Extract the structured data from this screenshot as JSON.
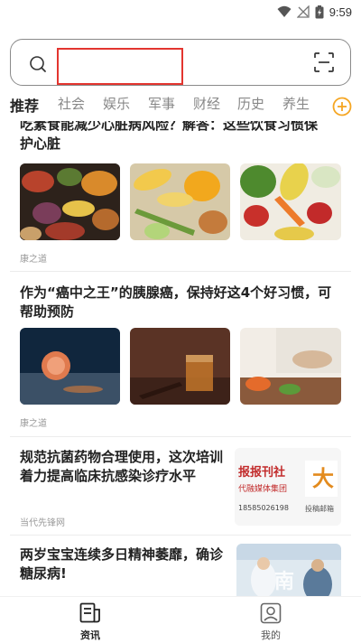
{
  "status": {
    "time": "9:59"
  },
  "search": {
    "placeholder": ""
  },
  "tabs": [
    "推荐",
    "社会",
    "娱乐",
    "军事",
    "财经",
    "历史",
    "养生"
  ],
  "articles": [
    {
      "title_line1": "吃素食能减少心脏病风险？解答：这些饮食习惯保",
      "title_line2": "护心脏",
      "source": "康之道"
    },
    {
      "title_line1": "作为“癌中之王”的胰腺癌，保持好这4个好习惯，可",
      "title_line2": "帮助预防",
      "source": "康之道"
    },
    {
      "title_line1": "规范抗菌药物合理使用，这次培训",
      "title_line2": "着力提高临床抗感染诊疗水平",
      "source": "当代先锋网",
      "thumb_text": {
        "left": "报报刊社",
        "sub": "代融媒体集团",
        "phone": "18585026198",
        "right_char": "大",
        "small": "投稿邮箱"
      }
    },
    {
      "title_line1": "两岁宝宝连续多日精神萎靡，确诊",
      "title_line2": "糖尿病!",
      "thumb_overlay": "南"
    }
  ],
  "bottom_nav": [
    {
      "label": "资讯",
      "active": true
    },
    {
      "label": "我的",
      "active": false
    }
  ],
  "colors": {
    "accent": "#f5a623",
    "highlight": "#e3352f"
  }
}
